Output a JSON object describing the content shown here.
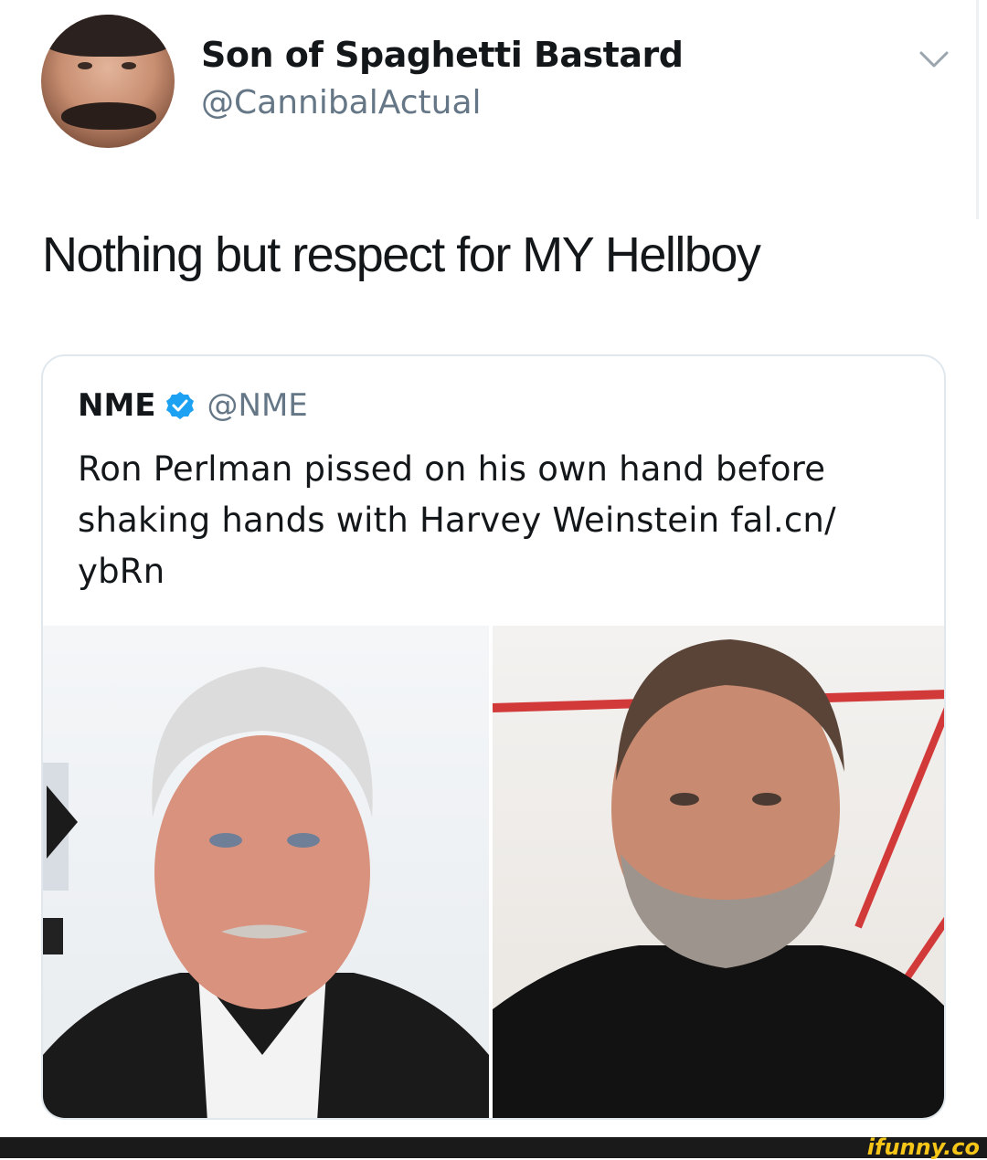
{
  "tweet": {
    "display_name": "Son of Spaghetti Bastard",
    "handle": "@CannibalActual",
    "text": "Nothing but respect for MY Hellboy"
  },
  "quoted_tweet": {
    "name": "NME",
    "handle": "@NME",
    "verified": true,
    "text_lines": [
      "Ron Perlman pissed on his own hand before",
      "shaking hands with Harvey Weinstein fal.cn/",
      "ybRn"
    ]
  },
  "footer": {
    "watermark": "ifunny.co"
  },
  "colors": {
    "text": "#14171a",
    "secondary": "#657786",
    "border": "#e1e8ed",
    "verified": "#1da1f2",
    "watermark": "#f5c518"
  },
  "icons": {
    "menu": "chevron-down-icon",
    "verified": "verified-badge-icon"
  }
}
